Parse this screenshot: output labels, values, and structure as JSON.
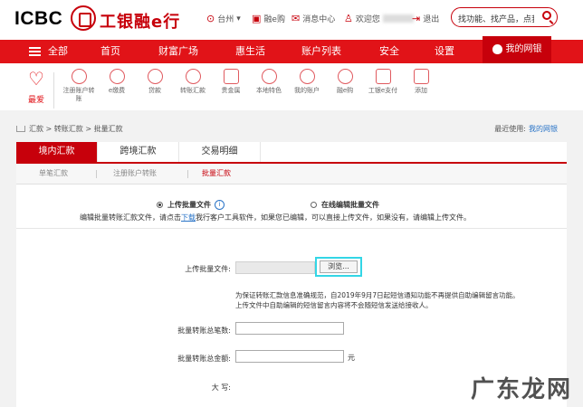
{
  "header": {
    "logo_text": "ICBC",
    "logo_cn": "工银融e行",
    "location": "台州",
    "location_caret": "▾",
    "links": [
      "融e购",
      "消息中心"
    ],
    "welcome": "欢迎您",
    "logout": "退出",
    "search_placeholder": "找功能、找产品，点我！"
  },
  "nav": {
    "items": [
      "全部",
      "首页",
      "财富广场",
      "惠生活",
      "账户列表",
      "安全",
      "设置"
    ],
    "my_bank": "我的网银"
  },
  "quick": {
    "favorite": "最爱",
    "items": [
      "注册账户转账",
      "e缴费",
      "贷款",
      "转账汇款",
      "贵金属",
      "本地特色",
      "我的账户",
      "融e购",
      "工银e支付",
      "添加"
    ]
  },
  "breadcrumb": {
    "path": "汇款 > 转账汇款 > 批量汇款",
    "recent_label": "最近使用:",
    "recent_link": "我的网银"
  },
  "tabs": [
    "境内汇款",
    "跨境汇款",
    "交易明细"
  ],
  "subtabs": [
    "单笔汇款",
    "注册账户转账",
    "批量汇款"
  ],
  "upload": {
    "option_file": "上传批量文件",
    "option_online": "在线编辑批量文件",
    "hint_before": "编辑批量转账汇款文件，请点击",
    "hint_link": "下载",
    "hint_after": "我行客户工具软件，如果您已编辑，可以直接上传文件，如果没有，请编辑上传文件。",
    "file_label": "上传批量文件:",
    "browse": "浏览...",
    "notice_line1": "为保证转账汇款信息准确规范，自2019年9月7日起短信通知功能不再提供自助编辑留言功能。",
    "notice_line2": "上传文件中自助编辑的短信留言内容将不会随短信发送给接收人。",
    "count_label": "批量转账总笔数:",
    "amount_label": "批量转账总金额:",
    "amount_unit": "元",
    "uppercase_label": "大 写:"
  },
  "watermark": "广东龙网",
  "colors": {
    "brand_red": "#c7000b",
    "nav_red": "#e11318",
    "highlight": "#33d6e6",
    "link_blue": "#2a74c7"
  }
}
